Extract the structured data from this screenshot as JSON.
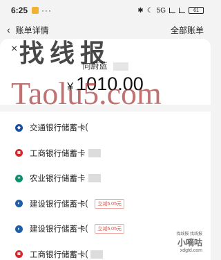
{
  "status_bar": {
    "time": "6:25",
    "more": "···",
    "network_label": "5G",
    "battery_label": "61"
  },
  "nav": {
    "back_glyph": "‹",
    "title": "账单详情",
    "right_label": "全部账单"
  },
  "sheet": {
    "close_glyph": "×",
    "payee_label": "向蔚蓝",
    "currency_symbol": "¥",
    "amount": "1010.00"
  },
  "accounts": [
    {
      "name": "交通银行储蓄卡",
      "suffix": "(",
      "icon": "bocom-icon",
      "color": "#1a4c9c",
      "badge": ""
    },
    {
      "name": "工商银行储蓄卡",
      "suffix": "",
      "icon": "icbc-icon",
      "color": "#d1272b",
      "badge": ""
    },
    {
      "name": "农业银行储蓄卡",
      "suffix": "",
      "icon": "abc-icon",
      "color": "#0a8f6c",
      "badge": ""
    },
    {
      "name": "建设银行储蓄卡",
      "suffix": "(",
      "icon": "ccb-icon",
      "color": "#1f5fa8",
      "badge": "立减5.05元"
    },
    {
      "name": "建设银行储蓄卡",
      "suffix": "(",
      "icon": "ccb-icon",
      "color": "#1f5fa8",
      "badge": "立减5.05元"
    },
    {
      "name": "工商银行储蓄卡",
      "suffix": "(",
      "icon": "icbc-icon",
      "color": "#d1272b",
      "badge": ""
    }
  ],
  "watermarks": {
    "cn": "找线报",
    "en": "Taolu5.com",
    "corner_line1": "找线报  找线报",
    "corner_line2": "小嘀咕",
    "corner_line3": "xdgtd.com"
  }
}
